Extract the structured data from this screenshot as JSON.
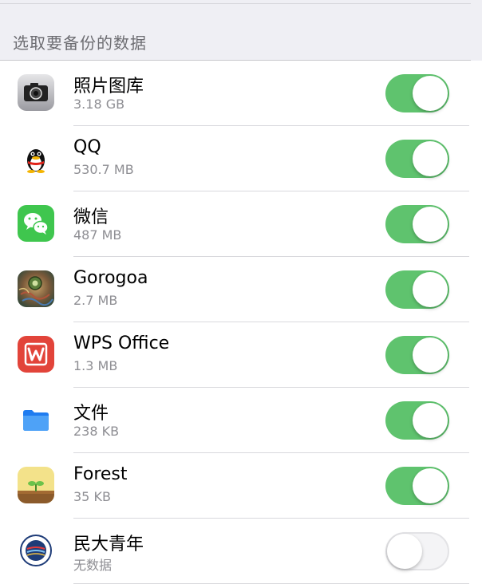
{
  "section": {
    "title": "选取要备份的数据"
  },
  "apps": [
    {
      "name": "照片图库",
      "size": "3.18 GB",
      "icon": "camera-icon",
      "enabled": true
    },
    {
      "name": "QQ",
      "size": "530.7 MB",
      "icon": "qq-penguin-icon",
      "enabled": true
    },
    {
      "name": "微信",
      "size": "487 MB",
      "icon": "wechat-icon",
      "enabled": true
    },
    {
      "name": "Gorogoa",
      "size": "2.7 MB",
      "icon": "gorogoa-icon",
      "enabled": true
    },
    {
      "name": "WPS Office",
      "size": "1.3 MB",
      "icon": "wps-office-icon",
      "enabled": true
    },
    {
      "name": "文件",
      "size": "238 KB",
      "icon": "files-folder-icon",
      "enabled": true
    },
    {
      "name": "Forest",
      "size": "35 KB",
      "icon": "forest-sprout-icon",
      "enabled": true
    },
    {
      "name": "民大青年",
      "size": "无数据",
      "icon": "mindaqingnian-emblem-icon",
      "enabled": false
    }
  ],
  "colors": {
    "toggle_on": "#5fc36e",
    "toggle_off": "#f4f4f6",
    "header_bg": "#efeff4"
  }
}
